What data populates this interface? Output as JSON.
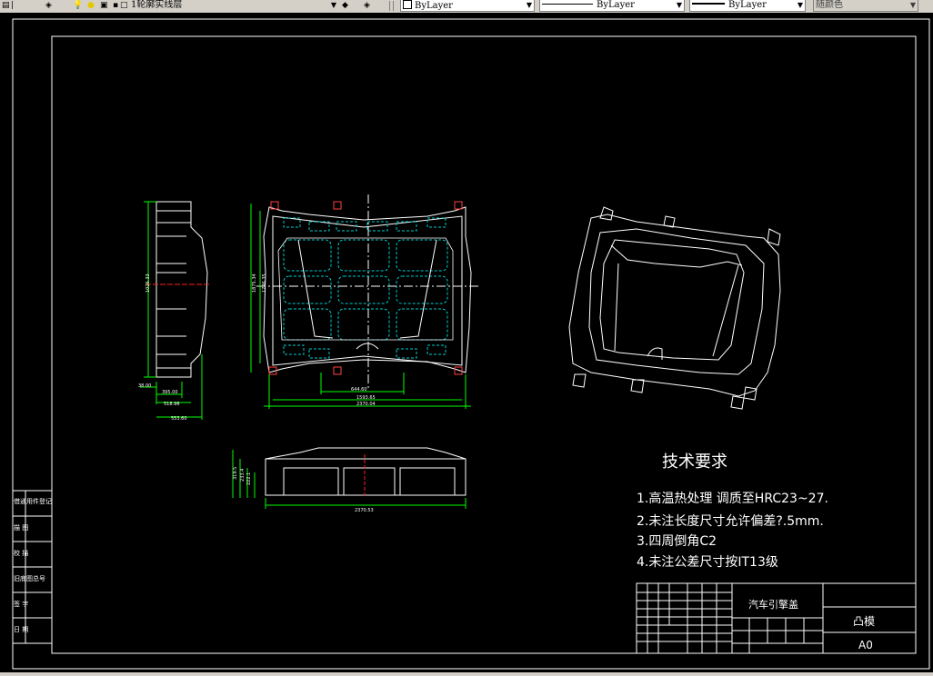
{
  "toolbar": {
    "layer_name": "1轮廓实线层",
    "color": "ByLayer",
    "linetype": "ByLayer",
    "lineweight": "ByLayer",
    "plotstyle": "随颜色"
  },
  "drawing": {
    "side_view_dims": [
      "1026.33",
      "38.00",
      "395.00",
      "518.96",
      "553.60"
    ],
    "plan_view_dims": [
      "1875.34",
      "1796.35",
      "644.60",
      "1593.65",
      "2370.04"
    ],
    "front_view_dims": [
      "2370.53",
      "319.5",
      "233.4",
      "222.1"
    ],
    "tech_requirements": {
      "title": "技术要求",
      "items": [
        "1.高温热处理  调质至HRC23~27.",
        "2.未注长度尺寸允许偏差?.5mm.",
        "3.四周倒角C2",
        "4.未注公差尺寸按IT13级"
      ]
    },
    "title_block": {
      "part_name": "汽车引擎盖",
      "drawing_name": "凸模",
      "size_code": "A0"
    },
    "side_labels": [
      "借通用件登记",
      "描  图",
      "校  描",
      "旧底图总号",
      "签  字",
      "日  期"
    ]
  }
}
